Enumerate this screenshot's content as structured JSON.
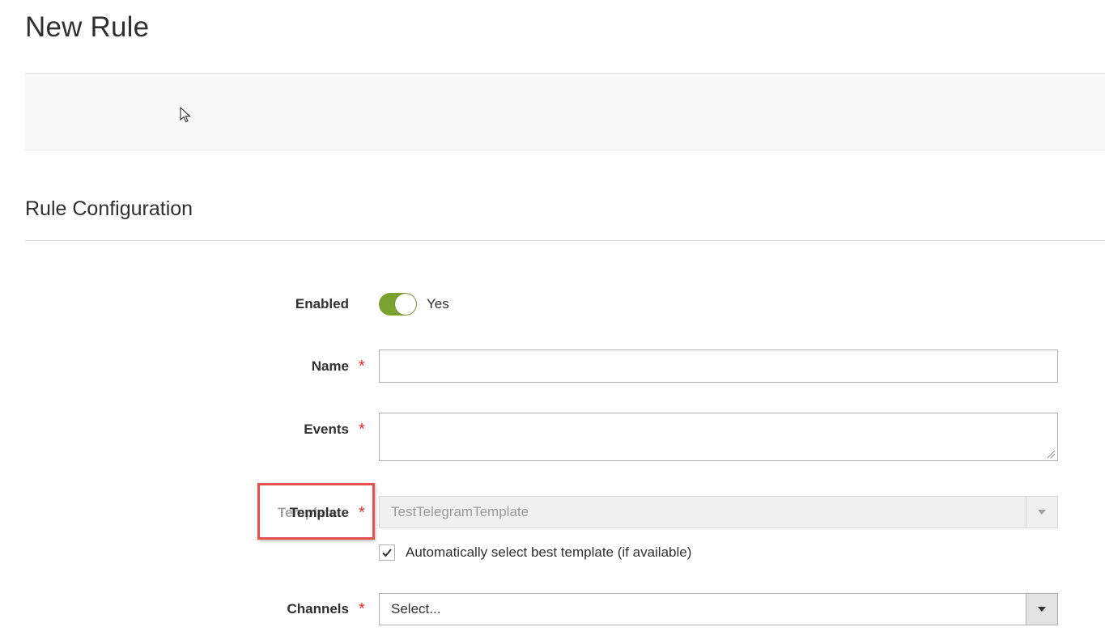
{
  "page": {
    "title": "New Rule"
  },
  "section": {
    "title": "Rule Configuration"
  },
  "form": {
    "enabled": {
      "label": "Enabled",
      "value_text": "Yes",
      "on": true
    },
    "name": {
      "label": "Name",
      "required_mark": "*",
      "value": "",
      "placeholder": ""
    },
    "events": {
      "label": "Events",
      "required_mark": "*",
      "value": ""
    },
    "template": {
      "label": "Template",
      "ghost_label": "Template",
      "required_mark": "*",
      "selected": "TestTelegramTemplate",
      "disabled": true
    },
    "auto_template": {
      "label": "Automatically select best template (if available)",
      "checked": true
    },
    "channels": {
      "label": "Channels",
      "required_mark": "*",
      "selected": "Select..."
    }
  },
  "colors": {
    "toggle_on": "#79a22e",
    "required": "#e02b27",
    "highlight": "#e5504f"
  },
  "icons": {
    "cursor": "mouse-pointer-icon",
    "select_arrow": "chevron-down-icon",
    "checkbox": "checkmark-icon",
    "resize": "resize-grip-icon"
  }
}
